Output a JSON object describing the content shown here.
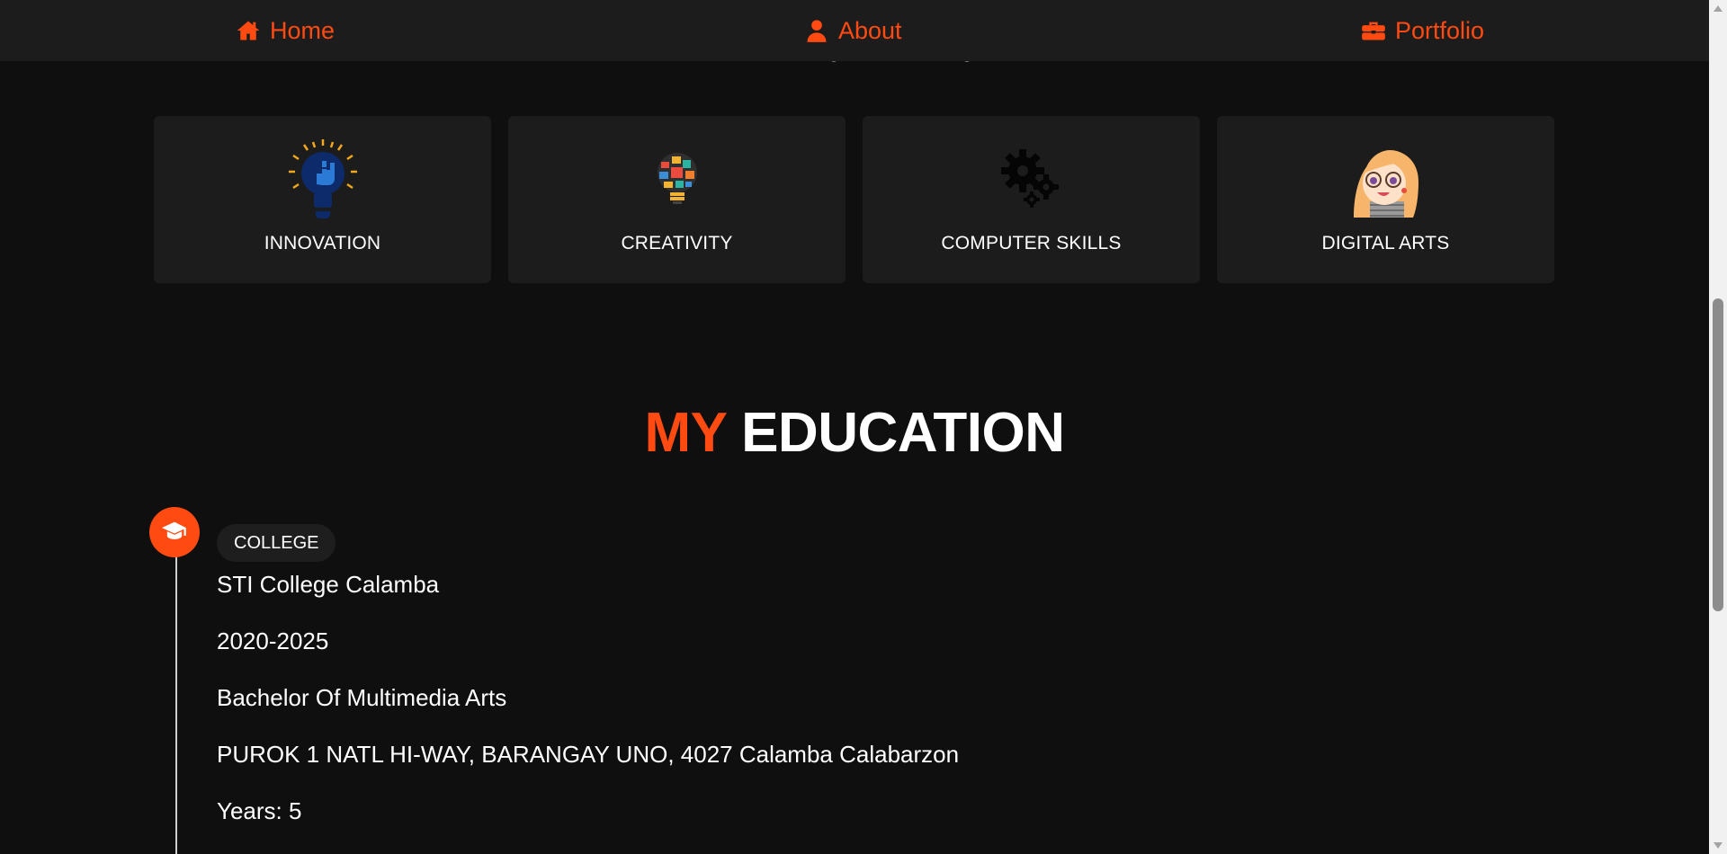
{
  "nav": {
    "items": [
      {
        "label": "Home",
        "icon": "home-icon"
      },
      {
        "label": "About",
        "icon": "user-icon"
      },
      {
        "label": "Portfolio",
        "icon": "briefcase-icon"
      }
    ]
  },
  "skills": [
    {
      "label": "INNOVATION",
      "icon": "lightbulb-fist-icon"
    },
    {
      "label": "CREATIVITY",
      "icon": "creative-bulb-icon"
    },
    {
      "label": "COMPUTER SKILLS",
      "icon": "gears-icon"
    },
    {
      "label": "DIGITAL ARTS",
      "icon": "anime-girl-icon"
    }
  ],
  "education": {
    "title_accent": "MY",
    "title_main": "EDUCATION",
    "entries": [
      {
        "badge": "COLLEGE",
        "icon": "graduation-cap-icon",
        "school": "STI College Calamba",
        "years_range": "2020-2025",
        "degree": "Bachelor Of Multimedia Arts",
        "address": "PUROK 1 NATL HI-WAY, BARANGAY UNO, 4027 Calamba Calabarzon",
        "duration": "Years: 5"
      }
    ]
  },
  "colors": {
    "accent": "#ff4a12",
    "background": "#0f0f0f",
    "card": "#1c1c1c",
    "text": "#ffffff"
  }
}
